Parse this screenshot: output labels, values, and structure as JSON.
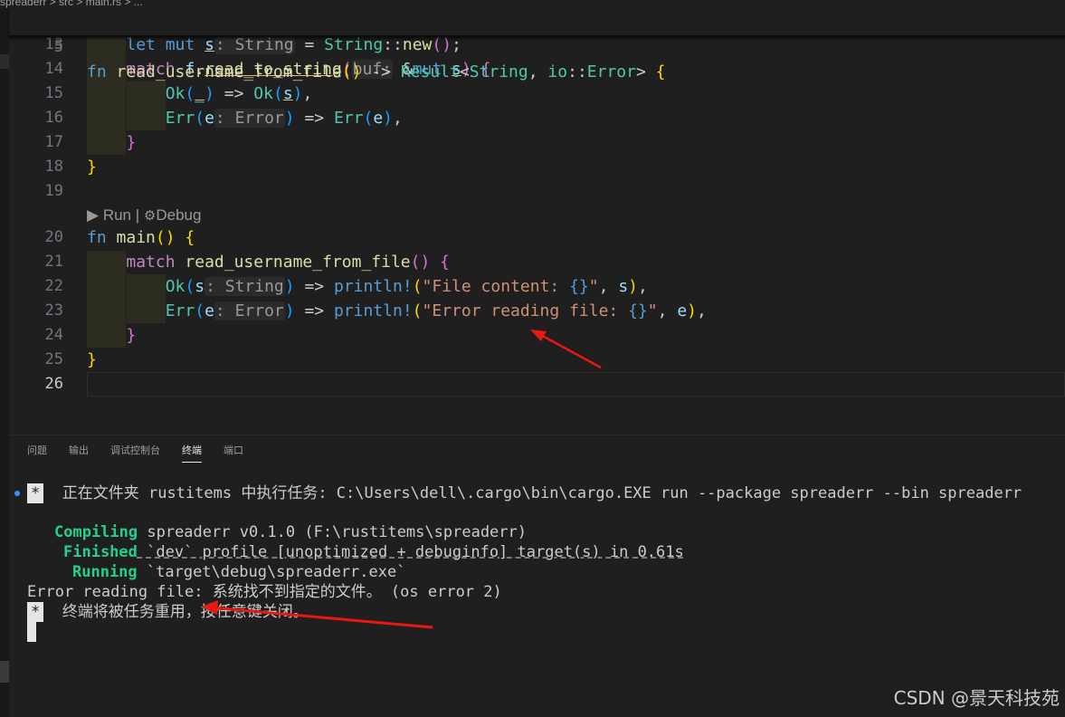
{
  "breadcrumb": {
    "text": "spreaderr > src > main.rs > ..."
  },
  "sticky": {
    "num": "5",
    "text": "fn read_username_from_file() -> Result<String, io::Error> {"
  },
  "editor": {
    "codelens": {
      "run": "Run",
      "sep": "|",
      "debug": "Debug"
    },
    "line_numbers": [
      "13",
      "14",
      "15",
      "16",
      "17",
      "18",
      "19",
      "20",
      "21",
      "22",
      "23",
      "24",
      "25",
      "26"
    ]
  },
  "panel": {
    "tabs": [
      "问题",
      "输出",
      "调试控制台",
      "终端",
      "端口"
    ]
  },
  "terminal": {
    "task_line": "正在文件夹 rustitems 中执行任务: C:\\Users\\dell\\.cargo\\bin\\cargo.EXE run --package spreaderr --bin spreaderr",
    "compiling_label": "Compiling",
    "compiling_text": " spreaderr v0.1.0 (F:\\rustitems\\spreaderr)",
    "finished_label": "Finished",
    "finished_text": " `dev` profile [unoptimized + debuginfo] target(s) in 0.61s",
    "running_label": "Running",
    "running_text": " `target\\debug\\spreaderr.exe`",
    "error_line": "Error reading file: 系统找不到指定的文件。 (os error 2)",
    "reuse_line": "终端将被任务重用，按任意键关闭。",
    "star": "*"
  },
  "watermark": "CSDN @景天科技苑",
  "colors": {
    "background": "#1f1f1f",
    "keyword": "#569cd6",
    "function": "#dcdcaa",
    "type": "#4ec9b0",
    "string": "#ce9178",
    "green": "#23d18b",
    "arrow": "#e8190f"
  }
}
